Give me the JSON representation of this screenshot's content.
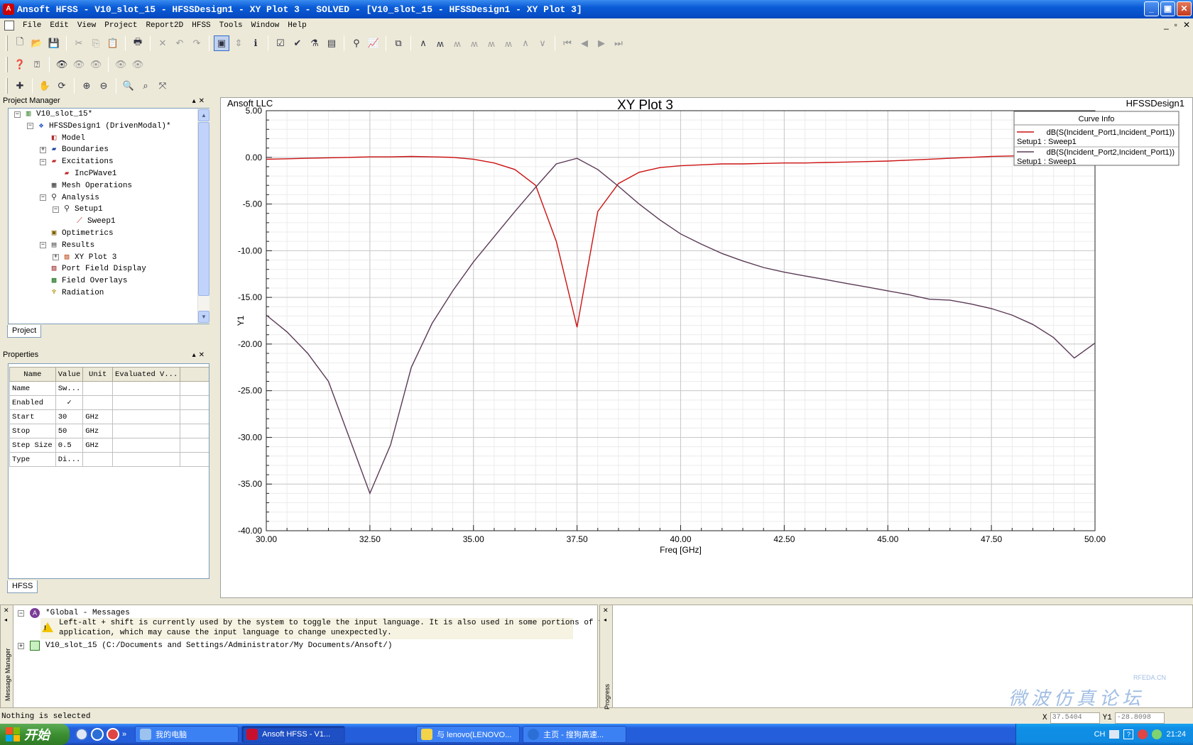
{
  "window": {
    "title": "Ansoft HFSS - V10_slot_15 - HFSSDesign1 - XY Plot 3 - SOLVED - [V10_slot_15 - HFSSDesign1 - XY Plot 3]",
    "buttons": [
      "_",
      "▣",
      "✕"
    ]
  },
  "menu": {
    "items": [
      "File",
      "Edit",
      "View",
      "Project",
      "Report2D",
      "HFSS",
      "Tools",
      "Window",
      "Help"
    ],
    "mdi_controls": [
      "_",
      "▫",
      "✕"
    ]
  },
  "project_manager": {
    "header": "Project Manager",
    "tab": "Project",
    "tree": [
      {
        "label": "V10_slot_15*",
        "icon": "project-icon",
        "depth": 0,
        "expander": "−"
      },
      {
        "label": "HFSSDesign1 (DrivenModal)*",
        "icon": "design-icon",
        "depth": 1,
        "expander": "−"
      },
      {
        "label": "Model",
        "icon": "model-icon",
        "depth": 2,
        "expander": ""
      },
      {
        "label": "Boundaries",
        "icon": "boundaries-icon",
        "depth": 2,
        "expander": "+"
      },
      {
        "label": "Excitations",
        "icon": "excitations-icon",
        "depth": 2,
        "expander": "−"
      },
      {
        "label": "IncPWave1",
        "icon": "incpwave-icon",
        "depth": 3,
        "expander": ""
      },
      {
        "label": "Mesh Operations",
        "icon": "mesh-icon",
        "depth": 2,
        "expander": ""
      },
      {
        "label": "Analysis",
        "icon": "analysis-icon",
        "depth": 2,
        "expander": "−"
      },
      {
        "label": "Setup1",
        "icon": "setup-icon",
        "depth": 3,
        "expander": "−"
      },
      {
        "label": "Sweep1",
        "icon": "sweep-icon",
        "depth": 4,
        "expander": ""
      },
      {
        "label": "Optimetrics",
        "icon": "optimetrics-icon",
        "depth": 2,
        "expander": ""
      },
      {
        "label": "Results",
        "icon": "results-icon",
        "depth": 2,
        "expander": "−"
      },
      {
        "label": "XY Plot 3",
        "icon": "xyplot-icon",
        "depth": 3,
        "expander": "+"
      },
      {
        "label": "Port Field Display",
        "icon": "port-field-icon",
        "depth": 2,
        "expander": ""
      },
      {
        "label": "Field Overlays",
        "icon": "field-overlays-icon",
        "depth": 2,
        "expander": ""
      },
      {
        "label": "Radiation",
        "icon": "radiation-icon",
        "depth": 2,
        "expander": ""
      }
    ]
  },
  "properties": {
    "header": "Properties",
    "tab": "HFSS",
    "columns": [
      "Name",
      "Value",
      "Unit",
      "Evaluated V..."
    ],
    "rows": [
      {
        "name": "Name",
        "value": "Sw...",
        "unit": "",
        "eval": ""
      },
      {
        "name": "Enabled",
        "value": "✓",
        "unit": "",
        "eval": ""
      },
      {
        "name": "Start",
        "value": "30",
        "unit": "GHz",
        "eval": ""
      },
      {
        "name": "Stop",
        "value": "50",
        "unit": "GHz",
        "eval": ""
      },
      {
        "name": "Step Size",
        "value": "0.5",
        "unit": "GHz",
        "eval": ""
      },
      {
        "name": "Type",
        "value": "Di...",
        "unit": "",
        "eval": ""
      }
    ]
  },
  "plot": {
    "company": "Ansoft LLC",
    "design": "HFSSDesign1",
    "legend_title": "Curve Info"
  },
  "chart_data": {
    "type": "line",
    "title": "XY Plot 3",
    "xlabel": "Freq [GHz]",
    "ylabel": "Y1",
    "xlim": [
      30,
      50
    ],
    "ylim": [
      -40,
      5
    ],
    "xticks": [
      "30.00",
      "32.50",
      "35.00",
      "37.50",
      "40.00",
      "42.50",
      "45.00",
      "47.50",
      "50.00"
    ],
    "yticks": [
      "5.00",
      "0.00",
      "-5.00",
      "-10.00",
      "-15.00",
      "-20.00",
      "-25.00",
      "-30.00",
      "-35.00",
      "-40.00"
    ],
    "grid": true,
    "legend": "top-right",
    "series": [
      {
        "name": "dB(S(Incident_Port1,Incident_Port1))",
        "setup": "Setup1 : Sweep1",
        "color": "#cc1111",
        "x": [
          30,
          30.5,
          31,
          31.5,
          32,
          32.5,
          33,
          33.5,
          34,
          34.5,
          35,
          35.5,
          36,
          36.5,
          37,
          37.5,
          38,
          38.5,
          39,
          39.5,
          40,
          40.5,
          41,
          41.5,
          42,
          42.5,
          43,
          43.5,
          44,
          44.5,
          45,
          45.5,
          46,
          46.5,
          47,
          47.5,
          48,
          48.5,
          49,
          49.5,
          50
        ],
        "y": [
          -0.2,
          -0.15,
          -0.1,
          -0.05,
          0.0,
          0.05,
          0.05,
          0.1,
          0.05,
          0.0,
          -0.2,
          -0.6,
          -1.3,
          -3.0,
          -9.0,
          -18.2,
          -5.8,
          -2.8,
          -1.6,
          -1.1,
          -0.9,
          -0.8,
          -0.7,
          -0.7,
          -0.65,
          -0.6,
          -0.6,
          -0.55,
          -0.5,
          -0.45,
          -0.4,
          -0.3,
          -0.2,
          -0.1,
          0.0,
          0.1,
          0.15,
          0.2,
          0.2,
          0.2,
          0.2
        ]
      },
      {
        "name": "dB(S(Incident_Port2,Incident_Port1))",
        "setup": "Setup1 : Sweep1",
        "color": "#5a3a55",
        "x": [
          30,
          30.5,
          31,
          31.5,
          32,
          32.5,
          33,
          33.5,
          34,
          34.5,
          35,
          35.5,
          36,
          36.5,
          37,
          37.5,
          38,
          38.5,
          39,
          39.5,
          40,
          40.5,
          41,
          41.5,
          42,
          42.5,
          43,
          43.5,
          44,
          44.5,
          45,
          45.5,
          46,
          46.5,
          47,
          47.5,
          48,
          48.5,
          49,
          49.5,
          50
        ],
        "y": [
          -16.9,
          -18.7,
          -21.0,
          -24.0,
          -30.0,
          -36.0,
          -30.8,
          -22.5,
          -17.8,
          -14.3,
          -11.2,
          -8.5,
          -5.8,
          -3.2,
          -0.7,
          -0.1,
          -1.3,
          -3.1,
          -5.0,
          -6.7,
          -8.2,
          -9.3,
          -10.3,
          -11.1,
          -11.8,
          -12.3,
          -12.7,
          -13.1,
          -13.5,
          -13.9,
          -14.3,
          -14.7,
          -15.2,
          -15.3,
          -15.7,
          -16.2,
          -16.9,
          -17.9,
          -19.3,
          -21.5,
          -19.9
        ]
      }
    ]
  },
  "messages": {
    "global_label": "*Global - Messages",
    "warning_line1": "Left-alt + shift is currently used by the system to toggle the input language. It is also used in some portions of this",
    "warning_line2": "application, which may cause the input language to change unexpectedly.",
    "project_line": "V10_slot_15 (C:/Documents and Settings/Administrator/My Documents/Ansoft/)",
    "side_label": "Message Manager",
    "progress_label": "Progress"
  },
  "status": {
    "text": "Nothing is selected",
    "x_label": "X",
    "x_value": "37.5404",
    "y_label": "Y1",
    "y_value": "-28.8098"
  },
  "taskbar": {
    "start": "开始",
    "tasks": [
      {
        "label": "我的电脑",
        "active": false
      },
      {
        "label": "Ansoft HFSS - V1...",
        "active": true
      },
      {
        "label": "与 lenovo(LENOVO...",
        "active": false
      },
      {
        "label": "主页 - 搜狗高速...",
        "active": false
      }
    ],
    "ime": "CH",
    "time": "21:24"
  },
  "watermark": {
    "line1": "微波仿真论坛",
    "line2": "RFEDA.CN"
  }
}
